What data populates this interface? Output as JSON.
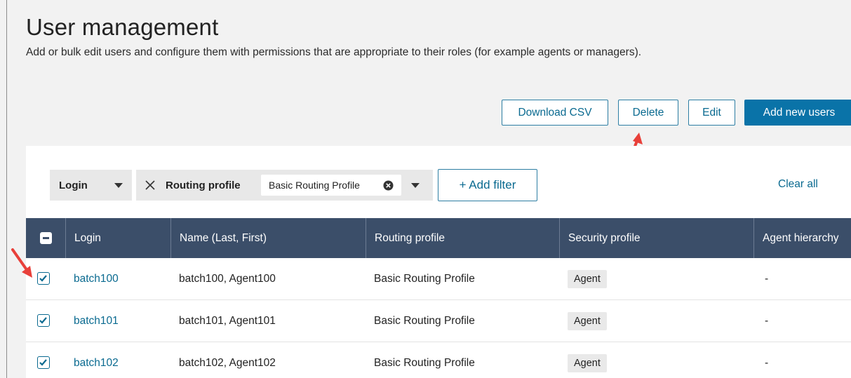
{
  "page": {
    "title": "User management",
    "description": "Add or bulk edit users and configure them with permissions that are appropriate to their roles (for example agents or managers)."
  },
  "actions": {
    "download_csv": "Download CSV",
    "delete": "Delete",
    "edit": "Edit",
    "add_new_users": "Add new users"
  },
  "filters": {
    "login_label": "Login",
    "routing_label": "Routing profile",
    "routing_value": "Basic Routing Profile",
    "add_filter": "+ Add filter",
    "clear_all": "Clear all"
  },
  "table": {
    "columns": [
      "Login",
      "Name (Last, First)",
      "Routing profile",
      "Security profile",
      "Agent hierarchy"
    ],
    "rows": [
      {
        "login": "batch100",
        "name": "batch100, Agent100",
        "routing": "Basic Routing Profile",
        "security": "Agent",
        "hierarchy": "-",
        "checked": true
      },
      {
        "login": "batch101",
        "name": "batch101, Agent101",
        "routing": "Basic Routing Profile",
        "security": "Agent",
        "hierarchy": "-",
        "checked": true
      },
      {
        "login": "batch102",
        "name": "batch102, Agent102",
        "routing": "Basic Routing Profile",
        "security": "Agent",
        "hierarchy": "-",
        "checked": true
      }
    ]
  },
  "colors": {
    "accent": "#0a73a8",
    "link": "#0a6a90",
    "header_bg": "#3b4e69",
    "annotation_arrow": "#e8403a"
  }
}
